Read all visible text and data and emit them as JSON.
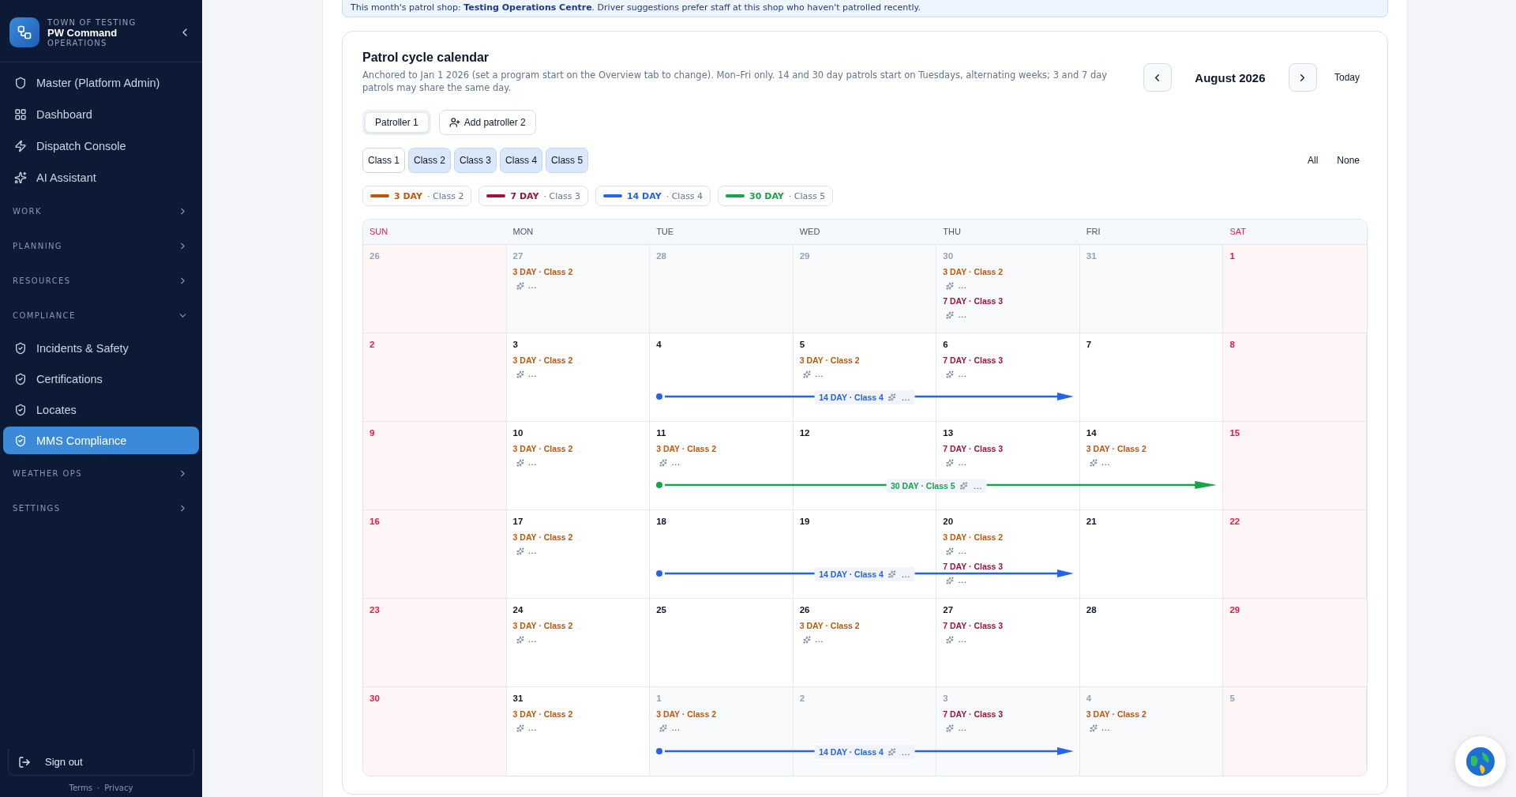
{
  "sidebar": {
    "org": "TOWN OF TESTING",
    "app": "PW Command",
    "subtitle": "OPERATIONS",
    "items": [
      {
        "kind": "link",
        "label": "Master (Platform Admin)",
        "selected": false
      },
      {
        "kind": "link",
        "label": "Dashboard",
        "selected": false
      },
      {
        "kind": "link",
        "label": "Dispatch Console",
        "selected": false
      },
      {
        "kind": "link",
        "label": "AI Assistant",
        "selected": false
      },
      {
        "kind": "section",
        "label": "WORK",
        "expanded": false
      },
      {
        "kind": "section",
        "label": "PLANNING",
        "expanded": false
      },
      {
        "kind": "section",
        "label": "RESOURCES",
        "expanded": false
      },
      {
        "kind": "section",
        "label": "COMPLIANCE",
        "expanded": true,
        "children": [
          {
            "label": "Incidents & Safety",
            "selected": false
          },
          {
            "label": "Certifications",
            "selected": false
          },
          {
            "label": "Locates",
            "selected": false
          },
          {
            "label": "MMS Compliance",
            "selected": true
          }
        ]
      },
      {
        "kind": "section",
        "label": "WEATHER OPS",
        "expanded": false
      },
      {
        "kind": "section",
        "label": "SETTINGS",
        "expanded": false
      }
    ],
    "sign_out": "Sign out",
    "footer_links": [
      "Terms",
      "Privacy"
    ],
    "footer_separator": "·"
  },
  "banner": "This month's patrol shop: **Testing Operations Centre**. Driver suggestions prefer staff at this shop who haven't patrolled recently.",
  "calendar": {
    "title": "Patrol cycle calendar",
    "description": "Anchored to Jan 1 2026 (set a program start on the Overview tab to change). Mon–Fri only. 14 and 30 day patrols start on Tuesdays, alternating weeks; 3 and 7 day patrols may share the same day.",
    "month": "August 2026",
    "today": "Today",
    "patrollers": [
      {
        "label": "Patroller 1",
        "selected": true
      }
    ],
    "add_patroller": "Add patroller 2",
    "classes": [
      {
        "label": "Class 1",
        "selected": false
      },
      {
        "label": "Class 2",
        "selected": true
      },
      {
        "label": "Class 3",
        "selected": true
      },
      {
        "label": "Class 4",
        "selected": true
      },
      {
        "label": "Class 5",
        "selected": true
      }
    ],
    "select_all": "All",
    "select_none": "None",
    "legend": [
      {
        "cycle": "3 DAY",
        "class": "· Class 2",
        "color": "#c2570c"
      },
      {
        "cycle": "7 DAY",
        "class": "· Class 3",
        "color": "#9f1239"
      },
      {
        "cycle": "14 DAY",
        "class": "· Class 4",
        "color": "#2563eb"
      },
      {
        "cycle": "30 DAY",
        "class": "· Class 5",
        "color": "#16a34a"
      }
    ],
    "weekdays": [
      {
        "label": "SUN",
        "weekend": true
      },
      {
        "label": "MON",
        "weekend": false
      },
      {
        "label": "TUE",
        "weekend": false
      },
      {
        "label": "WED",
        "weekend": false
      },
      {
        "label": "THU",
        "weekend": false
      },
      {
        "label": "FRI",
        "weekend": false
      },
      {
        "label": "SAT",
        "weekend": true
      }
    ],
    "weeks": [
      {
        "days": [
          {
            "day": "26",
            "muted": true
          },
          {
            "day": "27",
            "muted": true,
            "events": [
              {
                "label": "3 DAY · Class 2",
                "assignee": "…",
                "color": "#c2570c"
              }
            ]
          },
          {
            "day": "28",
            "muted": true
          },
          {
            "day": "29",
            "muted": true
          },
          {
            "day": "30",
            "muted": true,
            "events": [
              {
                "label": "3 DAY · Class 2",
                "assignee": "…",
                "color": "#c2570c"
              },
              {
                "label": "7 DAY · Class 3",
                "assignee": "…",
                "color": "#9f1239"
              }
            ]
          },
          {
            "day": "31",
            "muted": true
          },
          {
            "day": "1",
            "muted": false
          }
        ]
      },
      {
        "days": [
          {
            "day": "2",
            "muted": false
          },
          {
            "day": "3",
            "muted": false,
            "events": [
              {
                "label": "3 DAY · Class 2",
                "assignee": "…",
                "color": "#c2570c"
              }
            ]
          },
          {
            "day": "4",
            "muted": false,
            "bar": {
              "label": "14 DAY · Class 4",
              "assignee": "…",
              "color": "#2563eb"
            }
          },
          {
            "day": "5",
            "muted": false,
            "events": [
              {
                "label": "3 DAY · Class 2",
                "assignee": "…",
                "color": "#c2570c"
              }
            ],
            "in_bar": true
          },
          {
            "day": "6",
            "muted": false,
            "events": [
              {
                "label": "7 DAY · Class 3",
                "assignee": "…",
                "color": "#9f1239"
              }
            ],
            "in_bar": true
          },
          {
            "day": "7",
            "muted": false
          },
          {
            "day": "8",
            "muted": false
          }
        ]
      },
      {
        "days": [
          {
            "day": "9",
            "muted": false
          },
          {
            "day": "10",
            "muted": false,
            "events": [
              {
                "label": "3 DAY · Class 2",
                "assignee": "…",
                "color": "#c2570c"
              }
            ]
          },
          {
            "day": "11",
            "muted": false,
            "events": [
              {
                "label": "3 DAY · Class 2",
                "assignee": "…",
                "color": "#c2570c"
              }
            ],
            "bar": {
              "label": "30 DAY · Class 5",
              "assignee": "…",
              "color": "#16a34a"
            }
          },
          {
            "day": "12",
            "muted": false,
            "in_bar": true
          },
          {
            "day": "13",
            "muted": false,
            "events": [
              {
                "label": "7 DAY · Class 3",
                "assignee": "…",
                "color": "#9f1239"
              }
            ],
            "in_bar": true
          },
          {
            "day": "14",
            "muted": false,
            "events": [
              {
                "label": "3 DAY · Class 2",
                "assignee": "…",
                "color": "#c2570c"
              }
            ],
            "in_bar": true
          },
          {
            "day": "15",
            "muted": false
          }
        ]
      },
      {
        "days": [
          {
            "day": "16",
            "muted": false
          },
          {
            "day": "17",
            "muted": false,
            "events": [
              {
                "label": "3 DAY · Class 2",
                "assignee": "…",
                "color": "#c2570c"
              }
            ]
          },
          {
            "day": "18",
            "muted": false,
            "bar": {
              "label": "14 DAY · Class 4",
              "assignee": "…",
              "color": "#2563eb"
            }
          },
          {
            "day": "19",
            "muted": false,
            "in_bar": true
          },
          {
            "day": "20",
            "muted": false,
            "events": [
              {
                "label": "3 DAY · Class 2",
                "assignee": "…",
                "color": "#c2570c"
              },
              {
                "label": "7 DAY · Class 3",
                "assignee": "…",
                "color": "#9f1239"
              }
            ],
            "in_bar": true
          },
          {
            "day": "21",
            "muted": false
          },
          {
            "day": "22",
            "muted": false
          }
        ]
      },
      {
        "days": [
          {
            "day": "23",
            "muted": false
          },
          {
            "day": "24",
            "muted": false,
            "events": [
              {
                "label": "3 DAY · Class 2",
                "assignee": "…",
                "color": "#c2570c"
              }
            ]
          },
          {
            "day": "25",
            "muted": false
          },
          {
            "day": "26",
            "muted": false,
            "events": [
              {
                "label": "3 DAY · Class 2",
                "assignee": "…",
                "color": "#c2570c"
              }
            ]
          },
          {
            "day": "27",
            "muted": false,
            "events": [
              {
                "label": "7 DAY · Class 3",
                "assignee": "…",
                "color": "#9f1239"
              }
            ]
          },
          {
            "day": "28",
            "muted": false
          },
          {
            "day": "29",
            "muted": false
          }
        ]
      },
      {
        "days": [
          {
            "day": "30",
            "muted": false
          },
          {
            "day": "31",
            "muted": false,
            "events": [
              {
                "label": "3 DAY · Class 2",
                "assignee": "…",
                "color": "#c2570c"
              }
            ]
          },
          {
            "day": "1",
            "muted": true,
            "events": [
              {
                "label": "3 DAY · Class 2",
                "assignee": "…",
                "color": "#c2570c"
              }
            ],
            "bar": {
              "label": "14 DAY · Class 4",
              "assignee": "…",
              "color": "#2563eb"
            }
          },
          {
            "day": "2",
            "muted": true,
            "in_bar": true
          },
          {
            "day": "3",
            "muted": true,
            "events": [
              {
                "label": "7 DAY · Class 3",
                "assignee": "…",
                "color": "#9f1239"
              }
            ],
            "in_bar": true
          },
          {
            "day": "4",
            "muted": true,
            "events": [
              {
                "label": "3 DAY · Class 2",
                "assignee": "…",
                "color": "#c2570c"
              }
            ]
          },
          {
            "day": "5",
            "muted": true
          }
        ]
      }
    ]
  }
}
